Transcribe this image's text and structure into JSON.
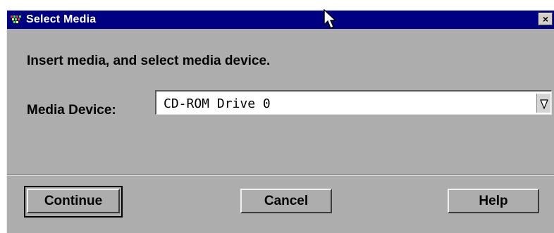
{
  "window": {
    "title": "Select Media",
    "close_glyph": "×",
    "titlebar_color": "#000082",
    "body_color": "#adadad"
  },
  "content": {
    "instruction": "Insert media, and select media device.",
    "device_label": "Media Device:",
    "device_select": {
      "selected_value": "CD-ROM Drive 0",
      "dropdown_icon": "chevron-down-icon"
    }
  },
  "buttons": {
    "continue": "Continue",
    "cancel": "Cancel",
    "help": "Help"
  },
  "icons": {
    "app": "app-icon",
    "close": "close-icon",
    "cursor": "mouse-pointer-icon"
  }
}
